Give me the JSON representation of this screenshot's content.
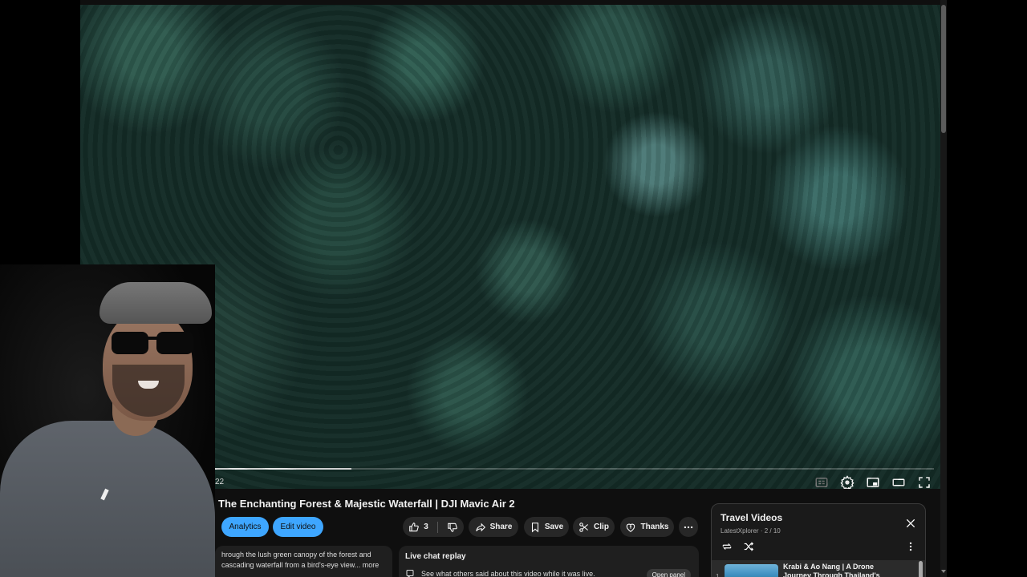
{
  "video": {
    "time_fragment": "22",
    "played_fraction": 0.19,
    "controls": [
      "subtitles-icon",
      "settings-icon",
      "miniplayer-icon",
      "theater-mode-icon",
      "fullscreen-icon"
    ]
  },
  "title": "The Enchanting Forest & Majestic Waterfall | DJI Mavic Air 2",
  "actions": {
    "analytics": "Analytics",
    "edit_video": "Edit video",
    "like_count": "3",
    "share": "Share",
    "save": "Save",
    "clip": "Clip",
    "thanks": "Thanks"
  },
  "description": {
    "line1": "hrough the lush green canopy of the forest and",
    "line2": "cascading waterfall from a bird's-eye view... more"
  },
  "chat": {
    "title": "Live chat replay",
    "subtitle": "See what others said about this video while it was live.",
    "open": "Open panel"
  },
  "playlist": {
    "title": "Travel Videos",
    "channel": "LatestXplorer",
    "position": "2 / 10",
    "items": [
      {
        "index": "1",
        "title": "Krabi & Ao Nang | A Drone Journey Through Thailand's"
      }
    ]
  },
  "colors": {
    "accent": "#3ea6ff",
    "background": "#0f0f0f",
    "surface": "#272727"
  }
}
